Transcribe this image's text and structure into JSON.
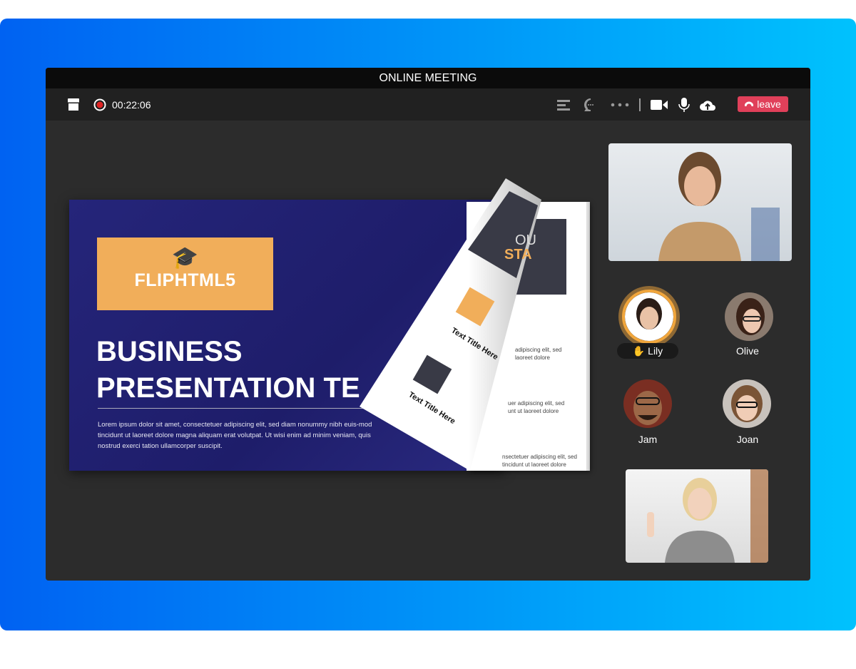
{
  "window": {
    "title": "ONLINE MEETING"
  },
  "toolbar": {
    "timer": "00:22:06",
    "leave_label": "leave",
    "icons": [
      "store-icon",
      "record-icon",
      "list-icon",
      "chat-icon",
      "more-icon",
      "camera-icon",
      "microphone-icon",
      "upload-cloud-icon",
      "phone-hangup-icon"
    ]
  },
  "slide": {
    "logo_text": "FLIPHTML5",
    "title_line1": "BUSINESS",
    "title_line2": "PRESENTATION TE",
    "body": "Lorem ipsum dolor sit amet, consectetuer adipiscing elit, sed diam nonummy nibh euis-mod tincidunt ut laoreet dolore magna aliquam erat volutpat. Ut wisi enim ad minim veniam, quis nostrud exerci tation ullamcorper suscipit.",
    "page": {
      "heading_a": "OU",
      "heading_b": "STA",
      "item_title": "Text Title Here",
      "item_text": "Lorem ipsum dolor sit amet, consectetuer adipiscing elit, sed diam nonummy nibh euismod tincidunt ut laoreet dolore",
      "right_lines": [
        "adipiscing elit, sed",
        "laoreet dolore",
        "uer adipiscing elit, sed",
        "unt ut laoreet dolore",
        "nsectetuer adipiscing elit, sed",
        "tincidunt ut laoreet dolore"
      ]
    }
  },
  "participants": [
    {
      "name": "Lily",
      "raised_hand": true,
      "speaking": true
    },
    {
      "name": "Olive"
    },
    {
      "name": "Jam"
    },
    {
      "name": "Joan"
    }
  ],
  "colors": {
    "accent_orange": "#f1ae5a",
    "leave_red": "#e0405a",
    "slide_navy": "#1f1f6e"
  }
}
